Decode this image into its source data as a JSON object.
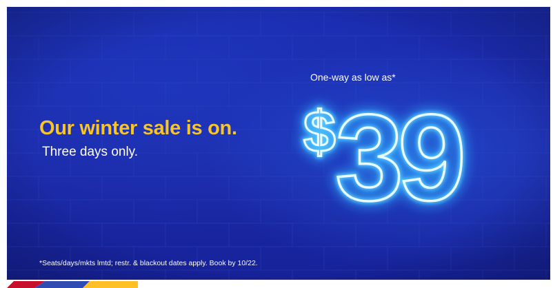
{
  "promo": {
    "headline": "Our winter sale is on.",
    "subheadline": "Three days only.",
    "eyebrow": "One-way as low as*",
    "price": "$39",
    "currency_symbol": "$",
    "amount": "39",
    "fine_print": "*Seats/days/mkts lmtd; restr. & blackout dates apply. Book by 10/22."
  },
  "colors": {
    "background": "#1d2ba8",
    "headline": "#f7c52a",
    "text": "#ffffff",
    "neon": "#9fe6ff",
    "neon_glow": "#2fb4ff",
    "stripe": [
      "#c8102e",
      "#304cb2",
      "#ffbf27"
    ]
  }
}
